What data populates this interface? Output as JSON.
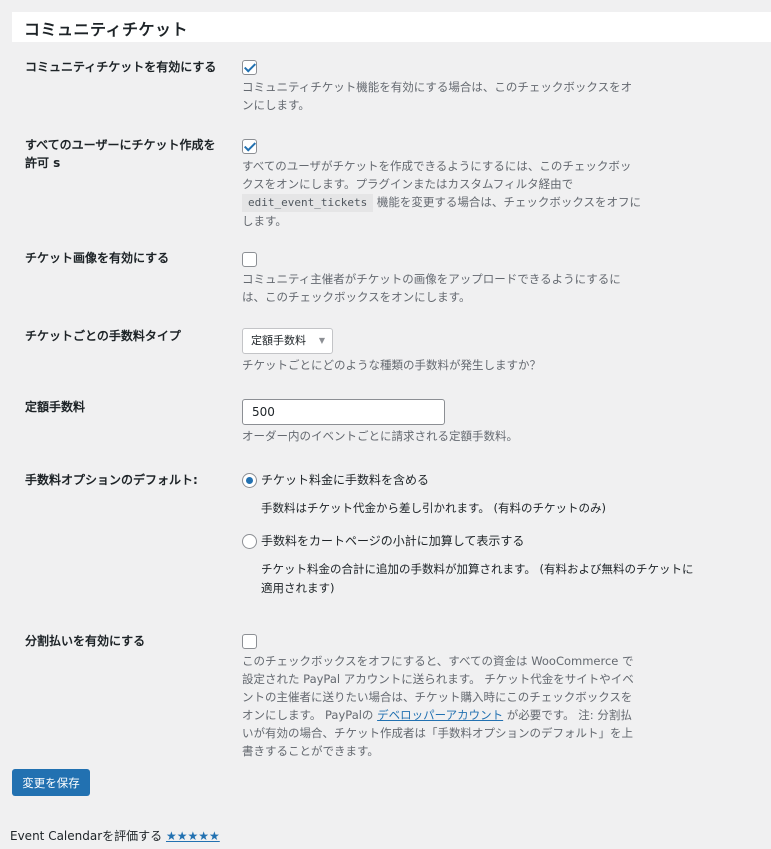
{
  "section_title": "コミュニティチケット",
  "settings": [
    {
      "label": "コミュニティチケットを有効にする",
      "checked": true,
      "desc": "コミュニティチケット機能を有効にする場合は、このチェックボックスをオンにします。"
    },
    {
      "label": "すべてのユーザーにチケット作成を許可 s",
      "checked": true,
      "desc_before": "すべてのユーザがチケットを作成できるようにするには、このチェックボックスをオンにします。プラグインまたはカスタムフィルタ経由で",
      "desc_code": "edit_event_tickets",
      "desc_after": "機能を変更する場合は、チェックボックスをオフにします。"
    },
    {
      "label": "チケット画像を有効にする",
      "checked": false,
      "desc": "コミュニティ主催者がチケットの画像をアップロードできるようにするには、このチェックボックスをオンにします。"
    }
  ],
  "fee_type": {
    "label": "チケットごとの手数料タイプ",
    "selected": "定額手数料",
    "desc": "チケットごとにどのような種類の手数料が発生しますか？"
  },
  "flat_fee": {
    "label": "定額手数料",
    "value": "500",
    "desc": "オーダー内のイベントごとに請求される定額手数料。"
  },
  "fee_default": {
    "label": "手数料オプションのデフォルト:",
    "options": [
      {
        "label": "チケット料金に手数料を含める",
        "selected": true,
        "desc": "手数料はチケット代金から差し引かれます。 (有料のチケットのみ)"
      },
      {
        "label": "手数料をカートページの小計に加算して表示する",
        "selected": false,
        "desc": "チケット料金の合計に追加の手数料が加算されます。 (有料および無料のチケットに適用されます)"
      }
    ]
  },
  "split_payment": {
    "label": "分割払いを有効にする",
    "checked": false,
    "desc_before": "このチェックボックスをオフにすると、すべての資金は WooCommerce で設定された PayPal アカウントに送られます。 チケット代金をサイトやイベントの主催者に送りたい場合は、チケット購入時にこのチェックボックスをオンにします。 PayPalの",
    "desc_link": "デベロッパーアカウント",
    "desc_after": "が必要です。 注: 分割払いが有効の場合、チケット作成者は「手数料オプションのデフォルト」を上書きすることができます。"
  },
  "save_button": "変更を保存",
  "footer": {
    "text": "Event Calendarを評価する",
    "stars": "★★★★★"
  },
  "colors": {
    "accent": "#2271b1",
    "background": "#f0f0f1",
    "muted_text": "#646970"
  }
}
